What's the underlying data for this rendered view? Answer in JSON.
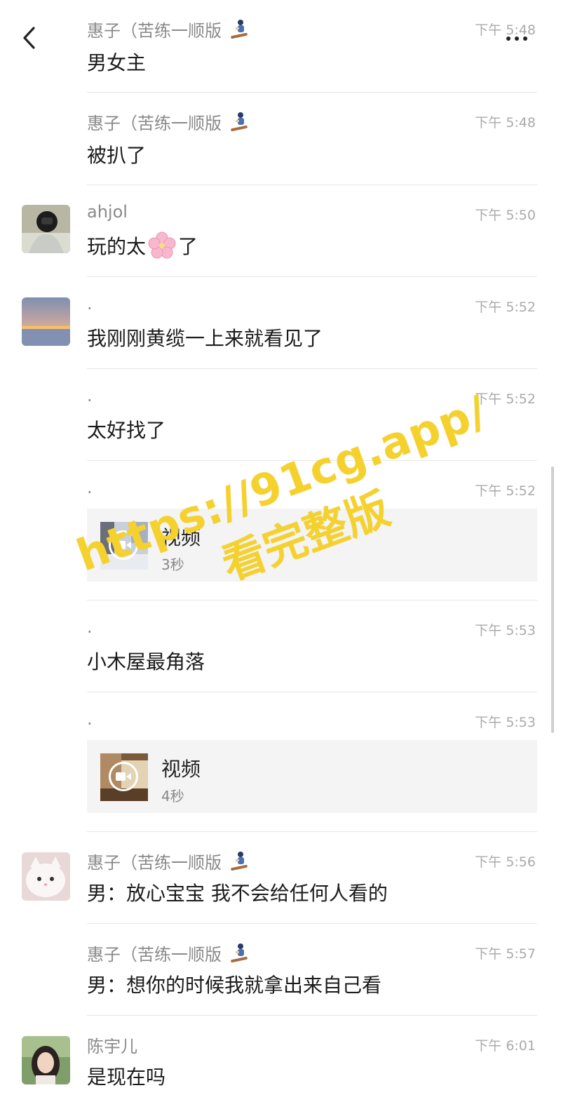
{
  "header": {
    "back_icon": "chevron-left-icon",
    "more_icon": "more-dots-icon"
  },
  "messages": [
    {
      "sender": "惠子（苦练一顺版",
      "sender_emoji": "snowboarder",
      "time": "下午 5:48",
      "text": "男女主",
      "avatar": "none"
    },
    {
      "sender": "惠子（苦练一顺版",
      "sender_emoji": "snowboarder",
      "time": "下午 5:48",
      "text": "被扒了",
      "avatar": "none"
    },
    {
      "sender": "ahjol",
      "time": "下午 5:50",
      "text_before": "玩的太",
      "text_emoji": "cherry-blossom",
      "text_after": "了",
      "avatar": "user-ahjol"
    },
    {
      "sender": ".",
      "time": "下午 5:52",
      "text": "我刚刚黄缆一上来就看见了",
      "avatar": "sunset-landscape"
    },
    {
      "sender": ".",
      "time": "下午 5:52",
      "text": "太好找了",
      "avatar": "none"
    },
    {
      "sender": ".",
      "time": "下午 5:52",
      "video_title": "视频",
      "video_duration": "3秒",
      "avatar": "none"
    },
    {
      "sender": ".",
      "time": "下午 5:53",
      "text": "小木屋最角落",
      "avatar": "none"
    },
    {
      "sender": ".",
      "time": "下午 5:53",
      "video_title": "视频",
      "video_duration": "4秒",
      "avatar": "none"
    },
    {
      "sender": "惠子（苦练一顺版",
      "sender_emoji": "snowboarder",
      "time": "下午 5:56",
      "text": "男：放心宝宝 我不会给任何人看的",
      "avatar": "white-cat"
    },
    {
      "sender": "惠子（苦练一顺版",
      "sender_emoji": "snowboarder",
      "time": "下午 5:57",
      "text": "男：想你的时候我就拿出来自己看",
      "avatar": "none"
    },
    {
      "sender": "陈宇儿",
      "time": "下午 6:01",
      "text": "是现在吗",
      "avatar": "girl-portrait"
    }
  ],
  "watermark": {
    "line1": "https://91cg.app/",
    "line2": "看完整版",
    "color": "#f5d12e"
  }
}
